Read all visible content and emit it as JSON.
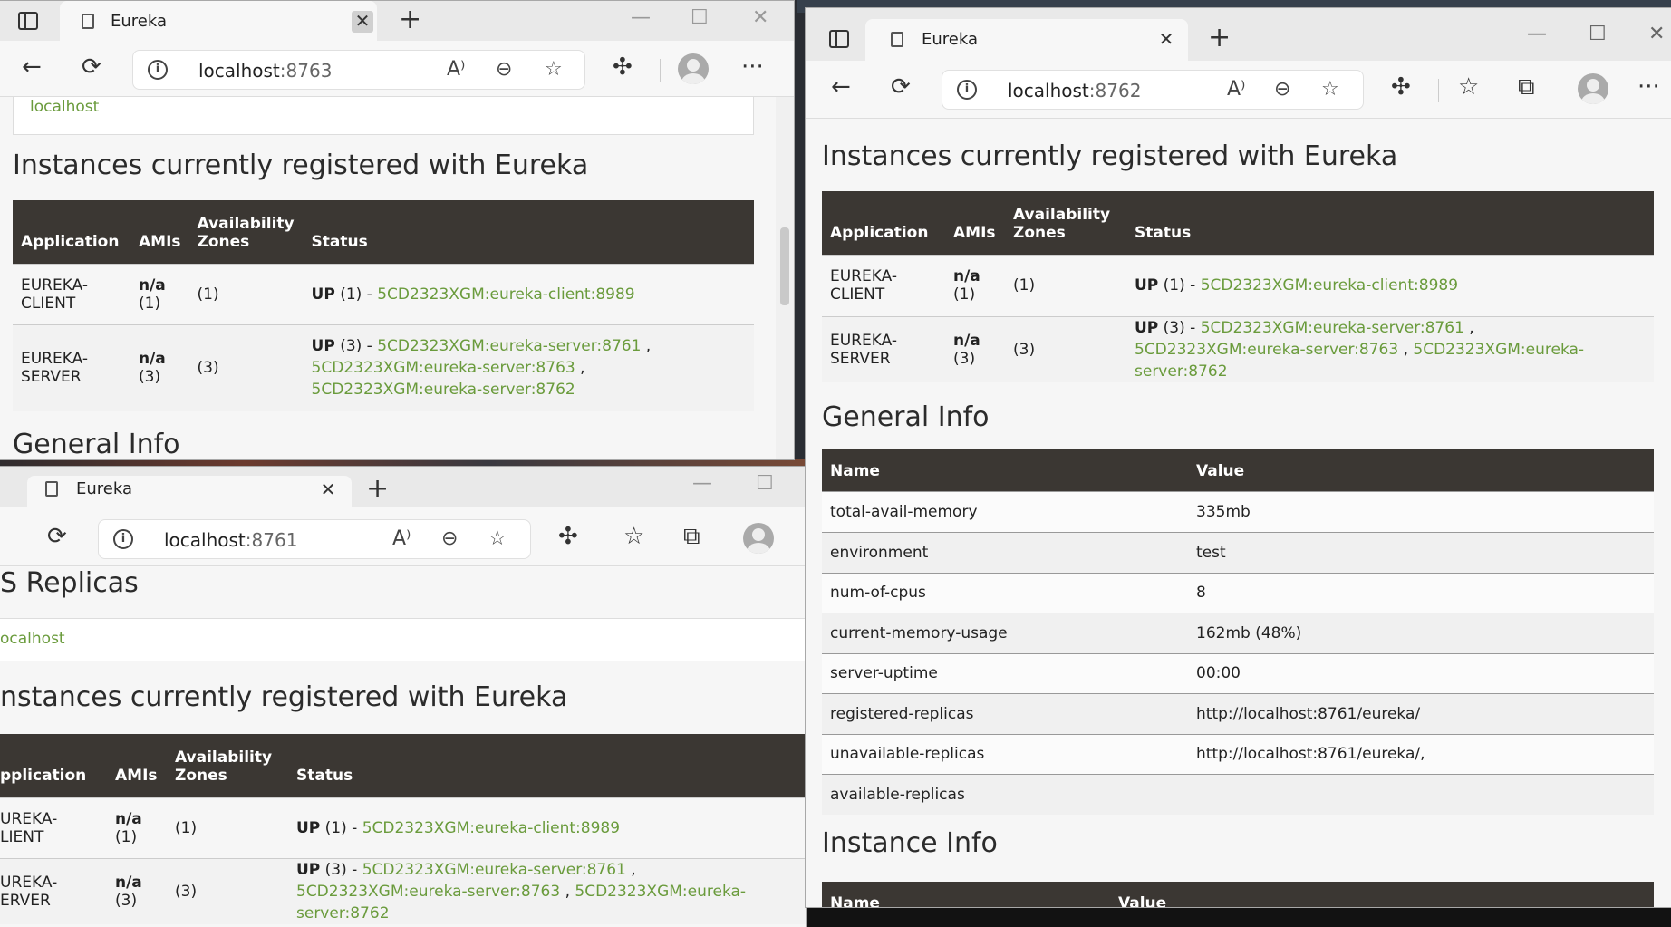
{
  "app_name": "Eureka",
  "tab_close": "✕",
  "new_tab": "+",
  "controls": {
    "minimize": "—",
    "maximize": "☐",
    "close": "✕"
  },
  "tb": {
    "back": "←",
    "refresh": "⟳",
    "more": "···"
  },
  "icons": {
    "read_aloud": "A⁾",
    "zoom": "⊖",
    "favorite_add": "☆",
    "extensions": "✣",
    "favorites": "☆",
    "collections": "⧉",
    "info": "i"
  },
  "w8763": {
    "url_host": "localhost",
    "url_port": ":8763",
    "host_link": "localhost",
    "heading_instances": "Instances currently registered with Eureka",
    "heading_general": "General Info"
  },
  "w8761": {
    "url_host": "localhost",
    "url_port": ":8761",
    "heading_replicas": "S Replicas",
    "host_link": "ocalhost",
    "heading_instances": "nstances currently registered with Eureka",
    "headers": {
      "application": "pplication",
      "amis": "AMIs",
      "zones": "Availability Zones",
      "status": "Status"
    },
    "rows": [
      {
        "app1": "UREKA-",
        "app2": "LIENT",
        "amis1": "n/a",
        "amis2": "(1)",
        "zones": "(1)",
        "up": "UP",
        "count": " (1) - ",
        "link1": "5CD2323XGM:eureka-client:8989",
        "sep": "",
        "link2": "",
        "link3": ""
      },
      {
        "app1": "UREKA-",
        "app2": "ERVER",
        "amis1": "n/a",
        "amis2": "(3)",
        "zones": "(3)",
        "up": "UP",
        "count": " (3) - ",
        "link1": "5CD2323XGM:eureka-server:8761",
        "sep": " , ",
        "link2": "5CD2323XGM:eureka-server:8763",
        "link3": "5CD2323XGM:eureka-server:8762"
      }
    ]
  },
  "w8762": {
    "url_host": "localhost",
    "url_port": ":8762",
    "heading_instances": "Instances currently registered with Eureka",
    "heading_general": "General Info",
    "heading_instance": "Instance Info"
  },
  "instance_table": {
    "headers": {
      "application": "Application",
      "amis": "AMIs",
      "zones": "Availability Zones",
      "status": "Status"
    },
    "rows": [
      {
        "app1": "EUREKA-",
        "app2": "CLIENT",
        "amis1": "n/a",
        "amis2": "(1)",
        "zones": "(1)",
        "up": "UP",
        "count": " (1) - ",
        "link1": "5CD2323XGM:eureka-client:8989",
        "sep": "",
        "link2": "",
        "link3": ""
      },
      {
        "app1": "EUREKA-",
        "app2": "SERVER",
        "amis1": "n/a",
        "amis2": "(3)",
        "zones": "(3)",
        "up": "UP",
        "count": " (3) - ",
        "link1": "5CD2323XGM:eureka-server:8761",
        "sep": " , ",
        "link2": "5CD2323XGM:eureka-server:8763",
        "link3": "5CD2323XGM:eureka-server:8762"
      }
    ]
  },
  "general_info": {
    "headers": {
      "name": "Name",
      "value": "Value"
    },
    "rows": [
      {
        "name": "total-avail-memory",
        "value": "335mb"
      },
      {
        "name": "environment",
        "value": "test"
      },
      {
        "name": "num-of-cpus",
        "value": "8"
      },
      {
        "name": "current-memory-usage",
        "value": "162mb (48%)"
      },
      {
        "name": "server-uptime",
        "value": "00:00"
      },
      {
        "name": "registered-replicas",
        "value": "http://localhost:8761/eureka/"
      },
      {
        "name": "unavailable-replicas",
        "value": "http://localhost:8761/eureka/,"
      },
      {
        "name": "available-replicas",
        "value": ""
      }
    ]
  },
  "instance_info": {
    "headers": {
      "name": "Name",
      "value": "Value"
    }
  }
}
